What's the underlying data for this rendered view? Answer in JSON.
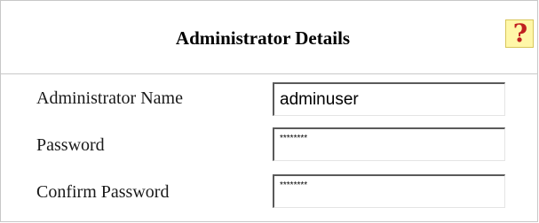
{
  "header": {
    "title": "Administrator Details",
    "help_icon": "help-question-icon"
  },
  "form": {
    "admin_name_label": "Administrator Name",
    "admin_name_value": "adminuser",
    "password_label": "Password",
    "password_value": "********",
    "confirm_password_label": "Confirm Password",
    "confirm_password_value": "********"
  },
  "colors": {
    "border": "#c8c8c8",
    "help_bg": "#fff7a8",
    "help_glyph": "#c02020"
  }
}
